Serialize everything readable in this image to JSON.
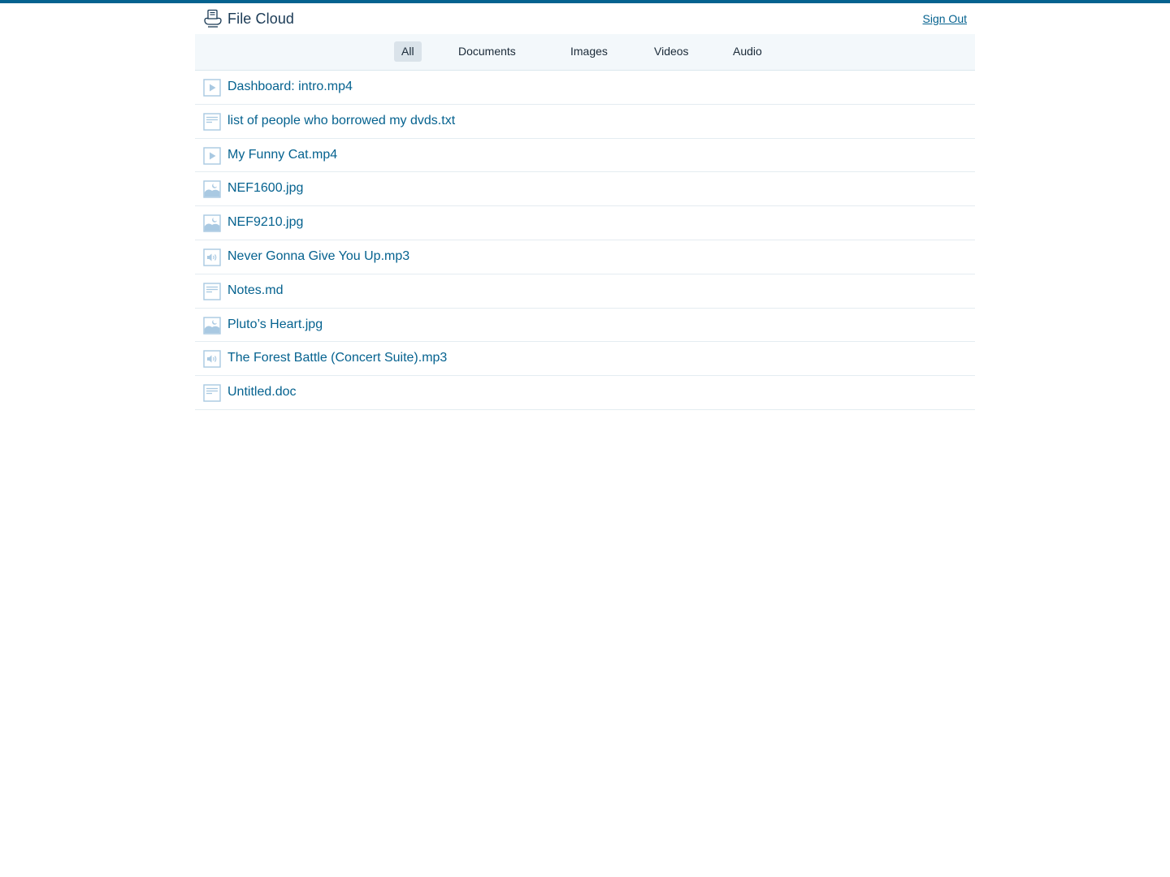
{
  "app": {
    "title": "File Cloud",
    "sign_out_label": "Sign Out",
    "logo_icon": "cloud-drive-icon"
  },
  "colors": {
    "accent": "#05628f",
    "tab_bar_bg": "#f3f8fb",
    "active_tab_bg": "#dae3ea",
    "icon_tint": "#a9c9e2"
  },
  "tabs": [
    {
      "label": "All",
      "active": true
    },
    {
      "label": "Documents",
      "active": false
    },
    {
      "label": "Images",
      "active": false
    },
    {
      "label": "Videos",
      "active": false
    },
    {
      "label": "Audio",
      "active": false
    }
  ],
  "files": [
    {
      "name": "Dashboard: intro.mp4",
      "icon": "video-file-icon"
    },
    {
      "name": "list of people who borrowed my dvds.txt",
      "icon": "document-file-icon"
    },
    {
      "name": "My Funny Cat.mp4",
      "icon": "video-file-icon"
    },
    {
      "name": "NEF1600.jpg",
      "icon": "image-file-icon"
    },
    {
      "name": "NEF9210.jpg",
      "icon": "image-file-icon"
    },
    {
      "name": "Never Gonna Give You Up.mp3",
      "icon": "audio-file-icon"
    },
    {
      "name": "Notes.md",
      "icon": "document-file-icon"
    },
    {
      "name": "Pluto’s Heart.jpg",
      "icon": "image-file-icon"
    },
    {
      "name": "The Forest Battle (Concert Suite).mp3",
      "icon": "audio-file-icon"
    },
    {
      "name": "Untitled.doc",
      "icon": "document-file-icon"
    }
  ]
}
